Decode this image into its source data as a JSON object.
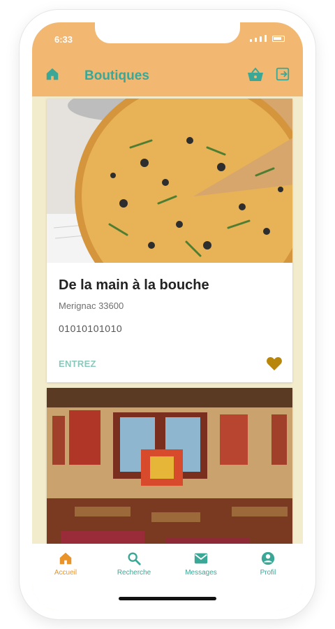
{
  "status": {
    "time": "6:33"
  },
  "header": {
    "title": "Boutiques",
    "icons": {
      "home": "home-icon",
      "basket": "basket-icon",
      "logout": "logout-icon"
    }
  },
  "shops": [
    {
      "name": "De la main à la bouche",
      "city": "Merignac 33600",
      "phone": "01010101010",
      "enter_label": "ENTREZ",
      "favorite": true
    }
  ],
  "tabs": [
    {
      "label": "Accueil",
      "icon": "home-icon",
      "active": true
    },
    {
      "label": "Recherche",
      "icon": "search-icon",
      "active": false
    },
    {
      "label": "Messages",
      "icon": "mail-icon",
      "active": false
    },
    {
      "label": "Profil",
      "icon": "account-icon",
      "active": false
    }
  ],
  "colors": {
    "header": "#f2b872",
    "accent": "#3aa797",
    "active_tab": "#e8942b",
    "background": "#f3eccc",
    "favorite": "#b8860b"
  }
}
